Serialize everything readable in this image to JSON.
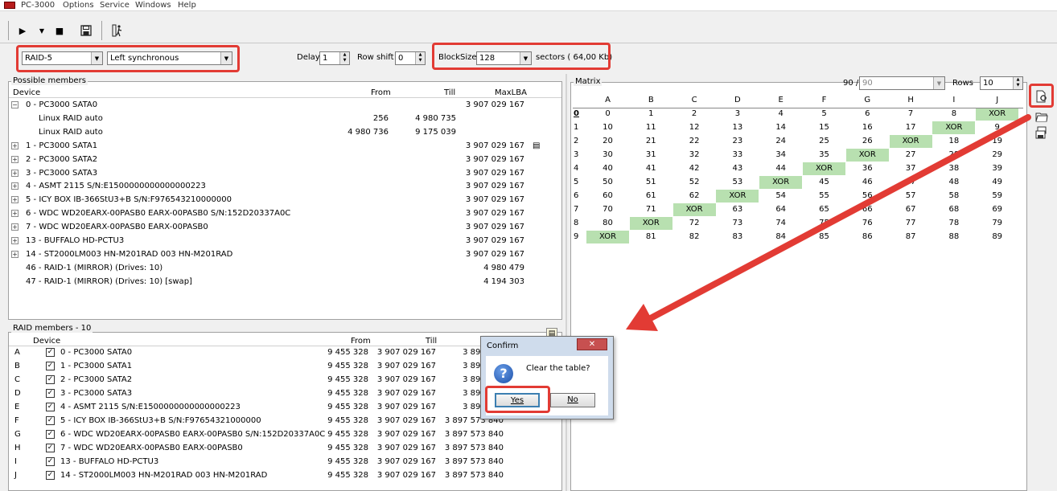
{
  "menu": {
    "app": "PC-3000",
    "items": [
      "Options",
      "Service",
      "Windows",
      "Help"
    ]
  },
  "toolbar": {
    "icons": [
      "play-icon",
      "dropdown-icon",
      "stop-icon",
      "save-icon",
      "exit-icon"
    ]
  },
  "config": {
    "raid_type": "RAID-5",
    "layout": "Left synchronous",
    "delay_label": "Delay",
    "delay_value": "1",
    "rowshift_label": "Row shift",
    "rowshift_value": "0",
    "blocksize_label": "BlockSize",
    "blocksize_value": "128",
    "sectors_label": "sectors ( 64,00 Kb)"
  },
  "possible_members": {
    "title": "Possible members",
    "headers": {
      "device": "Device",
      "from": "From",
      "till": "Till",
      "maxlba": "MaxLBA"
    },
    "rows": [
      {
        "expander": "−",
        "device": "0 - PC3000 SATA0",
        "from": "",
        "till": "",
        "maxlba": "3 907 029 167",
        "indent": 0
      },
      {
        "expander": "",
        "device": "Linux RAID auto",
        "from": "256",
        "till": "4 980 735",
        "maxlba": "",
        "indent": 1
      },
      {
        "expander": "",
        "device": "Linux RAID auto",
        "from": "4 980 736",
        "till": "9 175 039",
        "maxlba": "",
        "indent": 1
      },
      {
        "expander": "+",
        "device": "1 - PC3000 SATA1",
        "from": "",
        "till": "",
        "maxlba": "3 907 029 167",
        "indent": 0,
        "doc": true
      },
      {
        "expander": "+",
        "device": "2 - PC3000 SATA2",
        "from": "",
        "till": "",
        "maxlba": "3 907 029 167",
        "indent": 0
      },
      {
        "expander": "+",
        "device": "3 - PC3000 SATA3",
        "from": "",
        "till": "",
        "maxlba": "3 907 029 167",
        "indent": 0
      },
      {
        "expander": "+",
        "device": "4 - ASMT 2115 S/N:E1500000000000000223",
        "from": "",
        "till": "",
        "maxlba": "3 907 029 167",
        "indent": 0
      },
      {
        "expander": "+",
        "device": "5 - ICY BOX IB-366StU3+B S/N:F976543210000000",
        "from": "",
        "till": "",
        "maxlba": "3 907 029 167",
        "indent": 0
      },
      {
        "expander": "+",
        "device": "6 - WDC WD20EARX-00PASB0 EARX-00PASB0 S/N:152D20337A0C",
        "from": "",
        "till": "",
        "maxlba": "3 907 029 167",
        "indent": 0
      },
      {
        "expander": "+",
        "device": "7 - WDC WD20EARX-00PASB0 EARX-00PASB0",
        "from": "",
        "till": "",
        "maxlba": "3 907 029 167",
        "indent": 0
      },
      {
        "expander": "+",
        "device": "13 - BUFFALO HD-PCTU3",
        "from": "",
        "till": "",
        "maxlba": "3 907 029 167",
        "indent": 0
      },
      {
        "expander": "+",
        "device": "14 - ST2000LM003 HN-M201RAD 003 HN-M201RAD",
        "from": "",
        "till": "",
        "maxlba": "3 907 029 167",
        "indent": 0
      },
      {
        "expander": "",
        "device": "46 - RAID-1 (MIRROR) (Drives: 10)",
        "from": "",
        "till": "",
        "maxlba": "4 980 479",
        "indent": 0
      },
      {
        "expander": "",
        "device": "47 - RAID-1 (MIRROR) (Drives: 10) [swap]",
        "from": "",
        "till": "",
        "maxlba": "4 194 303",
        "indent": 0
      }
    ]
  },
  "raid_members": {
    "title": "RAID members - 10",
    "headers": {
      "device": "Device",
      "from": "From",
      "till": "Till"
    },
    "rows": [
      {
        "letter": "A",
        "device": "0 - PC3000 SATA0",
        "from": "9 455 328",
        "till": "3 907 029 167",
        "size": "3 897 574"
      },
      {
        "letter": "B",
        "device": "1 - PC3000 SATA1",
        "from": "9 455 328",
        "till": "3 907 029 167",
        "size": "3 897 574"
      },
      {
        "letter": "C",
        "device": "2 - PC3000 SATA2",
        "from": "9 455 328",
        "till": "3 907 029 167",
        "size": "3 897 574"
      },
      {
        "letter": "D",
        "device": "3 - PC3000 SATA3",
        "from": "9 455 328",
        "till": "3 907 029 167",
        "size": "3 897 574"
      },
      {
        "letter": "E",
        "device": "4 - ASMT 2115 S/N:E1500000000000000223",
        "from": "9 455 328",
        "till": "3 907 029 167",
        "size": "3 897 574"
      },
      {
        "letter": "F",
        "device": "5 - ICY BOX IB-366StU3+B S/N:F97654321000000",
        "from": "9 455 328",
        "till": "3 907 029 167",
        "size": "3 897 573 840"
      },
      {
        "letter": "G",
        "device": "6 - WDC WD20EARX-00PASB0 EARX-00PASB0 S/N:152D20337A0C",
        "from": "9 455 328",
        "till": "3 907 029 167",
        "size": "3 897 573 840"
      },
      {
        "letter": "H",
        "device": "7 - WDC WD20EARX-00PASB0 EARX-00PASB0",
        "from": "9 455 328",
        "till": "3 907 029 167",
        "size": "3 897 573 840"
      },
      {
        "letter": "I",
        "device": "13 - BUFFALO HD-PCTU3",
        "from": "9 455 328",
        "till": "3 907 029 167",
        "size": "3 897 573 840"
      },
      {
        "letter": "J",
        "device": "14 - ST2000LM003 HN-M201RAD 003 HN-M201RAD",
        "from": "9 455 328",
        "till": "3 907 029 167",
        "size": "3 897 573 840"
      }
    ]
  },
  "matrix": {
    "title": "Matrix",
    "count_text": "90 /",
    "count_value": "90",
    "rows_label": "Rows",
    "rows_value": "10",
    "columns": [
      "A",
      "B",
      "C",
      "D",
      "E",
      "F",
      "G",
      "H",
      "I",
      "J"
    ],
    "row_labels": [
      "0",
      "1",
      "2",
      "3",
      "4",
      "5",
      "6",
      "7",
      "8",
      "9"
    ],
    "cells": [
      [
        "0",
        "1",
        "2",
        "3",
        "4",
        "5",
        "6",
        "7",
        "8",
        "XOR"
      ],
      [
        "10",
        "11",
        "12",
        "13",
        "14",
        "15",
        "16",
        "17",
        "XOR",
        "9"
      ],
      [
        "20",
        "21",
        "22",
        "23",
        "24",
        "25",
        "26",
        "XOR",
        "18",
        "19"
      ],
      [
        "30",
        "31",
        "32",
        "33",
        "34",
        "35",
        "XOR",
        "27",
        "28",
        "29"
      ],
      [
        "40",
        "41",
        "42",
        "43",
        "44",
        "XOR",
        "36",
        "37",
        "38",
        "39"
      ],
      [
        "50",
        "51",
        "52",
        "53",
        "XOR",
        "45",
        "46",
        "47",
        "48",
        "49"
      ],
      [
        "60",
        "61",
        "62",
        "XOR",
        "54",
        "55",
        "56",
        "57",
        "58",
        "59"
      ],
      [
        "70",
        "71",
        "XOR",
        "63",
        "64",
        "65",
        "66",
        "67",
        "68",
        "69"
      ],
      [
        "80",
        "XOR",
        "72",
        "73",
        "74",
        "75",
        "76",
        "77",
        "78",
        "79"
      ],
      [
        "XOR",
        "81",
        "82",
        "83",
        "84",
        "85",
        "86",
        "87",
        "88",
        "89"
      ]
    ]
  },
  "dialog": {
    "title": "Confirm",
    "close": "✕",
    "message": "Clear the table?",
    "yes": "Yes",
    "no": "No"
  },
  "colors": {
    "highlight": "#e23b34",
    "xor_fill": "#b8e0b0"
  }
}
